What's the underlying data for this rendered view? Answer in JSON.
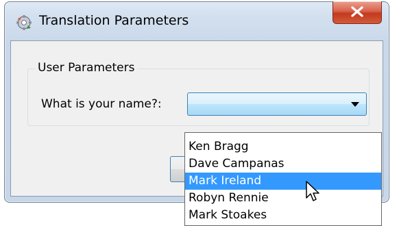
{
  "window": {
    "title": "Translation Parameters",
    "app_icon": "gear-icon",
    "close_icon": "close-icon"
  },
  "group": {
    "legend": "User Parameters",
    "field_label": "What is your name?:",
    "combo_value": ""
  },
  "dropdown": {
    "options": [
      "",
      "Ken Bragg",
      "Dave Campanas",
      "Mark Ireland",
      "Robyn Rennie",
      "Mark Stoakes"
    ],
    "selected_index": 3
  },
  "buttons": {
    "ok_label": "",
    "cancel_label": ""
  },
  "colors": {
    "selection": "#3399ff",
    "close_button": "#c43a1e"
  }
}
